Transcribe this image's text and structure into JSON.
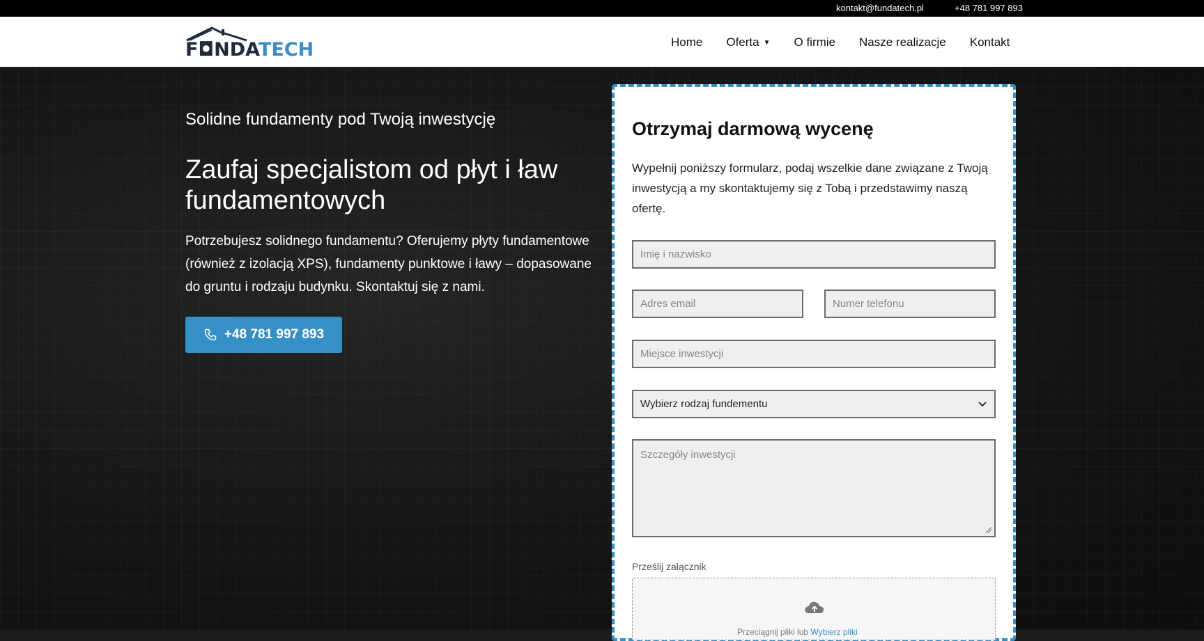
{
  "topbar": {
    "email": "kontakt@fundatech.pl",
    "phone": "+48 781 997 893"
  },
  "brand": {
    "part1": "F",
    "part2": "NDA",
    "part3": "TECH",
    "dark_color": "#1f2a3a",
    "accent_color": "#3d8cc4"
  },
  "nav": {
    "home": "Home",
    "oferta": "Oferta",
    "o_firmie": "O firmie",
    "realizacje": "Nasze realizacje",
    "kontakt": "Kontakt"
  },
  "hero": {
    "subtitle": "Solidne fundamenty pod Twoją inwestycję",
    "title": "Zaufaj specjalistom od płyt i ław fundamentowych",
    "text": "Potrzebujesz solidnego fundamentu? Oferujemy płyty fundamentowe (również z izolacją XPS), fundamenty punktowe i ławy – dopasowane do gruntu i rodzaju budynku. Skontaktuj się z nami.",
    "cta_phone": "+48 781 997 893",
    "cta_icon": "phone-icon"
  },
  "form": {
    "title": "Otrzymaj darmową wycenę",
    "intro": "Wypełnij poniższy formularz, podaj wszelkie dane związane z Twoją inwestycją a my skontaktujemy się z Tobą i przedstawimy naszą ofertę.",
    "name_placeholder": "Imię i nazwisko",
    "email_placeholder": "Adres email",
    "phone_placeholder": "Numer telefonu",
    "location_placeholder": "Miejsce inwestycji",
    "foundation_select": "Wybierz rodzaj fundementu",
    "details_placeholder": "Szczegóły inwestycji",
    "attachment_label": "Prześlij załącznik",
    "drop_text": "Przeciągnij pliki lub",
    "drop_link": "Wybierz pliki",
    "border_color": "#3590c6"
  }
}
